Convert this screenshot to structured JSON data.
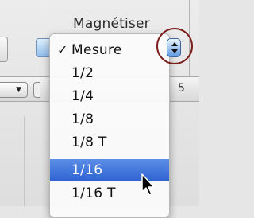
{
  "header": {
    "title": "Magnétiser"
  },
  "toolbar": {
    "number": "5"
  },
  "menu": {
    "items": [
      {
        "label": "Mesure",
        "checked": true,
        "selected": false
      },
      {
        "label": "1/2",
        "checked": false,
        "selected": false
      },
      {
        "label": "1/4",
        "checked": false,
        "selected": false
      },
      {
        "label": "1/8",
        "checked": false,
        "selected": false
      },
      {
        "label": "1/8 T",
        "checked": false,
        "selected": false
      },
      {
        "label": "1/16",
        "checked": false,
        "selected": true
      },
      {
        "label": "1/16 T",
        "checked": false,
        "selected": false
      }
    ],
    "check_glyph": "✓"
  },
  "colors": {
    "highlight": "#3a6fd8",
    "annotation_ring": "#7a1e1e",
    "stepper": "#5f9ae0"
  },
  "icons": {
    "pointer": "arrow-cursor-icon",
    "stepper": "up-down-stepper-icon"
  }
}
